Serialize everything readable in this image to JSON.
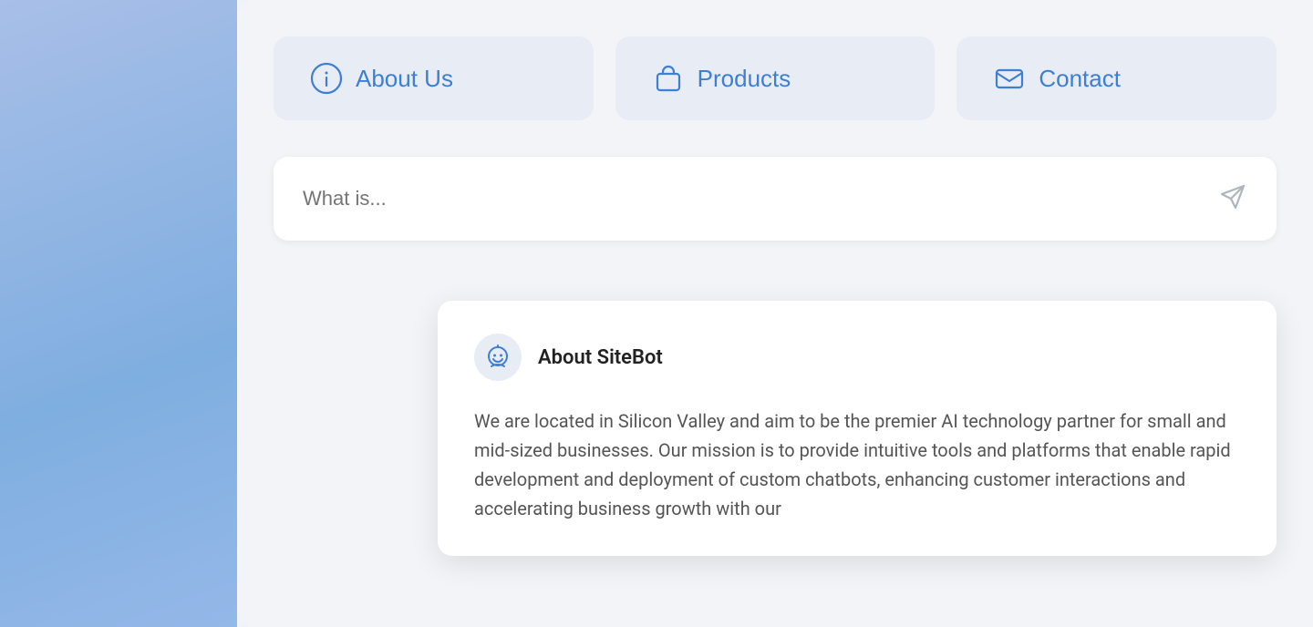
{
  "background": {
    "left_color": "#a8bfe8"
  },
  "nav": {
    "buttons": [
      {
        "id": "about-us",
        "label": "About Us",
        "icon": "info-icon"
      },
      {
        "id": "products",
        "label": "Products",
        "icon": "bag-icon"
      },
      {
        "id": "contact",
        "label": "Contact",
        "icon": "mail-icon"
      }
    ]
  },
  "search": {
    "placeholder": "What is...",
    "send_icon": "send-icon"
  },
  "dropdown": {
    "bot_icon": "chat-bot-icon",
    "title": "About SiteBot",
    "body": "We are located in Silicon Valley and aim to be the premier AI technology partner for small and mid-sized businesses. Our mission is to provide intuitive tools and platforms that enable rapid development and deployment of custom chatbots, enhancing customer interactions and accelerating business growth with our"
  }
}
